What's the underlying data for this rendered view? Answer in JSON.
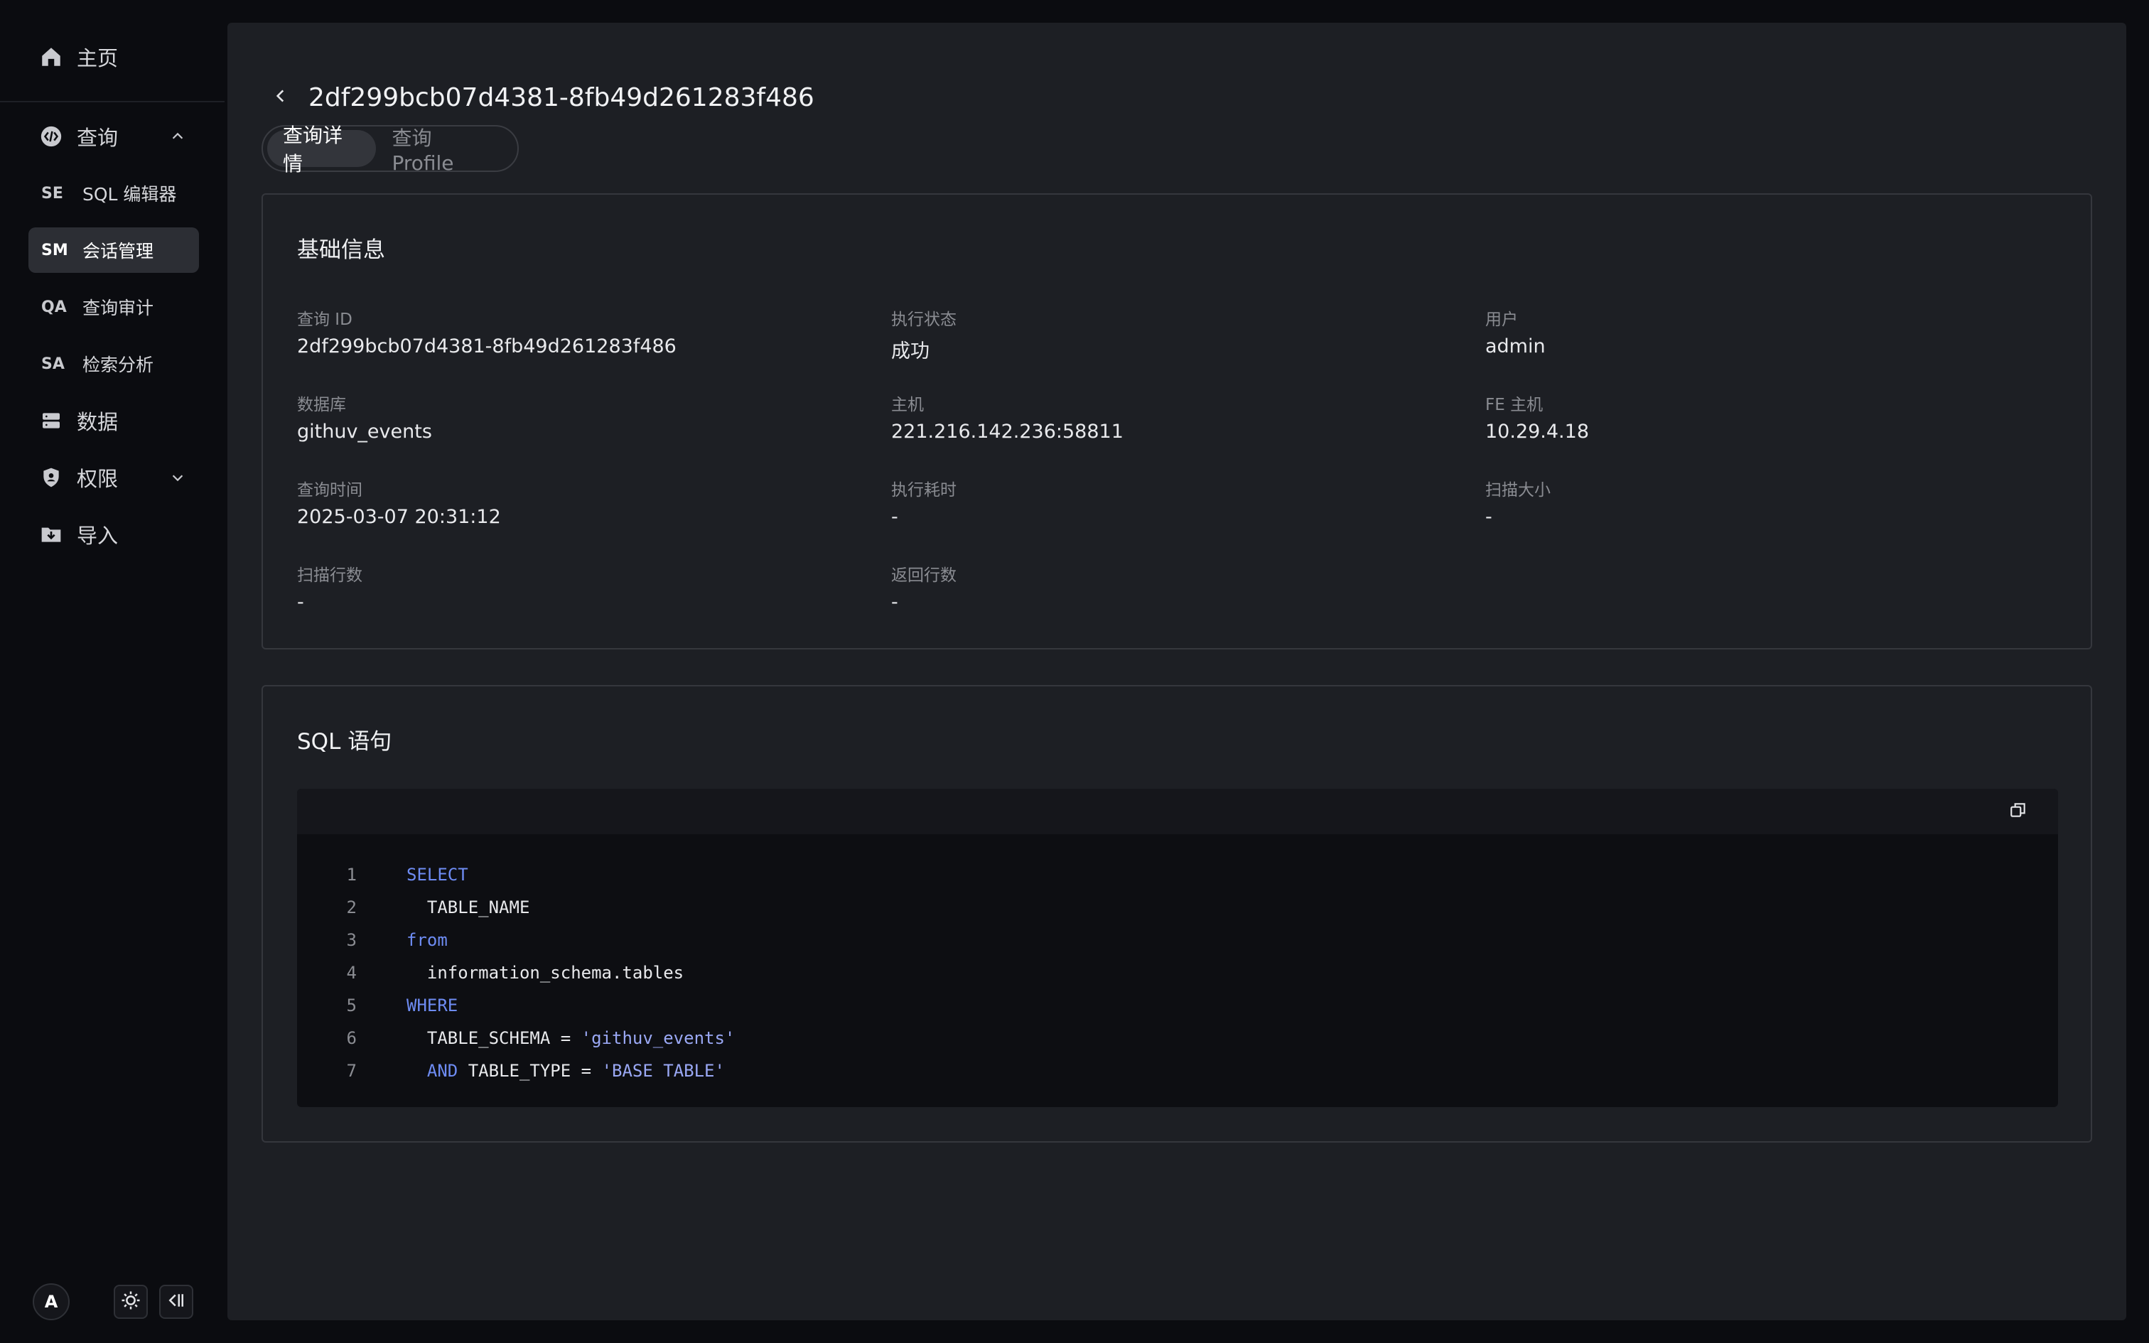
{
  "sidebar": {
    "home": "主页",
    "query": "查询",
    "sub_items": [
      {
        "abbr": "SE",
        "label": "SQL 编辑器"
      },
      {
        "abbr": "SM",
        "label": "会话管理"
      },
      {
        "abbr": "QA",
        "label": "查询审计"
      },
      {
        "abbr": "SA",
        "label": "检索分析"
      }
    ],
    "data": "数据",
    "permission": "权限",
    "import": "导入",
    "avatar": "A"
  },
  "header": {
    "title": "2df299bcb07d4381-8fb49d261283f486"
  },
  "tabs": [
    {
      "label": "查询详情",
      "active": true
    },
    {
      "label": "查询 Profile",
      "active": false
    }
  ],
  "basic_info": {
    "title": "基础信息",
    "fields": [
      {
        "key": "查询 ID",
        "value": "2df299bcb07d4381-8fb49d261283f486"
      },
      {
        "key": "执行状态",
        "value": "成功"
      },
      {
        "key": "用户",
        "value": "admin"
      },
      {
        "key": "数据库",
        "value": "githuv_events"
      },
      {
        "key": "主机",
        "value": "221.216.142.236:58811"
      },
      {
        "key": "FE 主机",
        "value": "10.29.4.18"
      },
      {
        "key": "查询时间",
        "value": "2025-03-07 20:31:12"
      },
      {
        "key": "执行耗时",
        "value": "-"
      },
      {
        "key": "扫描大小",
        "value": "-"
      },
      {
        "key": "扫描行数",
        "value": "-"
      },
      {
        "key": "返回行数",
        "value": "-"
      }
    ]
  },
  "sql": {
    "title": "SQL 语句",
    "lines": [
      {
        "n": "1",
        "tokens": [
          {
            "t": "SELECT",
            "c": "kw"
          }
        ]
      },
      {
        "n": "2",
        "tokens": [
          {
            "t": "  TABLE_NAME",
            "c": ""
          }
        ]
      },
      {
        "n": "3",
        "tokens": [
          {
            "t": "from",
            "c": "kw"
          }
        ]
      },
      {
        "n": "4",
        "tokens": [
          {
            "t": "  information_schema.tables",
            "c": ""
          }
        ]
      },
      {
        "n": "5",
        "tokens": [
          {
            "t": "WHERE",
            "c": "kw"
          }
        ]
      },
      {
        "n": "6",
        "tokens": [
          {
            "t": "  TABLE_SCHEMA = ",
            "c": ""
          },
          {
            "t": "'githuv_events'",
            "c": "str"
          }
        ]
      },
      {
        "n": "7",
        "tokens": [
          {
            "t": "  ",
            "c": ""
          },
          {
            "t": "AND",
            "c": "kw"
          },
          {
            "t": " TABLE_TYPE = ",
            "c": ""
          },
          {
            "t": "'BASE TABLE'",
            "c": "str"
          }
        ]
      }
    ]
  },
  "icons": {
    "home": "home-icon",
    "query": "query-icon",
    "data": "database-icon",
    "permission": "shield-icon",
    "import": "import-folder-icon",
    "theme": "sun-icon",
    "collapse": "collapse-sidebar-icon",
    "copy": "copy-icon",
    "back": "chevron-left-icon"
  },
  "colors": {
    "keyword": "#6e8cf3",
    "string": "#9aa8f4",
    "panel": "#1d1f24",
    "background": "#0b0c10",
    "active_nav": "#2c2e34"
  }
}
